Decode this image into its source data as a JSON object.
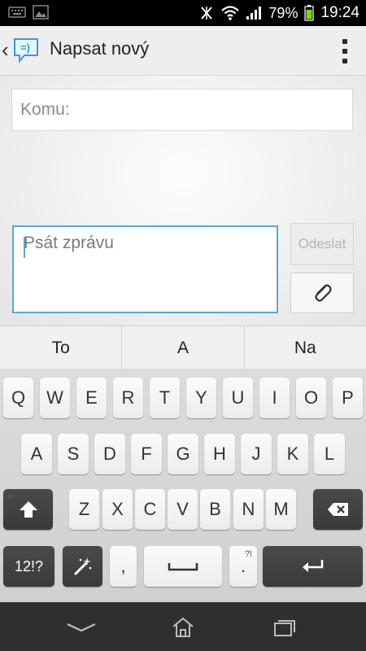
{
  "status_bar": {
    "battery_percent": "79%",
    "time": "19:24",
    "icons": [
      "keyboard-icon",
      "image-icon",
      "nfc-icon",
      "wifi-icon",
      "signal-icon",
      "battery-icon"
    ]
  },
  "action_bar": {
    "title": "Napsat nový",
    "icons": [
      "back-chevron-icon",
      "messaging-app-icon",
      "overflow-menu-icon"
    ]
  },
  "compose": {
    "to_placeholder": "Komu:",
    "to_value": "",
    "message_placeholder": "Psát zprávu",
    "message_value": "",
    "send_label": "Odeslat",
    "attach_icon": "paperclip-icon"
  },
  "suggestions": [
    "To",
    "A",
    "Na"
  ],
  "keyboard": {
    "row1": [
      "Q",
      "W",
      "E",
      "R",
      "T",
      "Y",
      "U",
      "I",
      "O",
      "P"
    ],
    "row2": [
      "A",
      "S",
      "D",
      "F",
      "G",
      "H",
      "J",
      "K",
      "L"
    ],
    "row3": [
      "Z",
      "X",
      "C",
      "V",
      "B",
      "N",
      "M"
    ],
    "symbols_label": "12!?",
    "comma_label": ",",
    "period_label": ".",
    "period_alt_label": "?!",
    "icons": [
      "shift-icon",
      "backspace-icon",
      "magic-wand-icon",
      "space-icon",
      "enter-icon"
    ]
  },
  "nav_bar": {
    "icons": [
      "back-nav-icon",
      "home-nav-icon",
      "recent-apps-icon"
    ]
  },
  "colors": {
    "accent": "#5aa5d8",
    "status_bar": "#000000",
    "nav_bar": "#2f2f2f",
    "dark_key": "#3f3f3f"
  }
}
